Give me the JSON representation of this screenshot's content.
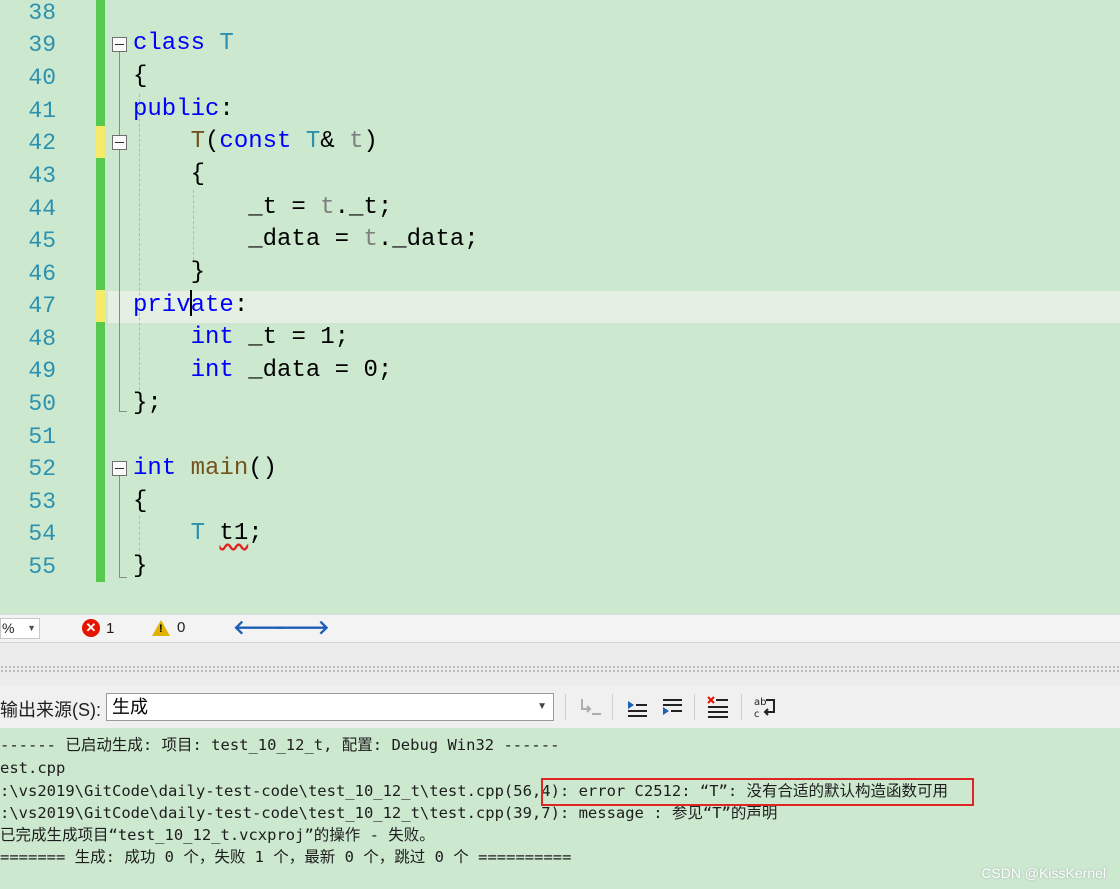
{
  "editor": {
    "line_numbers": [
      "38",
      "39",
      "40",
      "41",
      "42",
      "43",
      "44",
      "45",
      "46",
      "47",
      "48",
      "49",
      "50",
      "51",
      "52",
      "53",
      "54",
      "55"
    ],
    "tokens": {
      "class_kw": "class",
      "class_name": "T",
      "brace_open": "{",
      "brace_close": "}",
      "public_kw": "public",
      "private_kw_a": "priv",
      "private_kw_b": "ate",
      "colon": ":",
      "ctor_name": "T",
      "paren_open": "(",
      "const_kw": "const",
      "param_type": "T",
      "amp": "&",
      "param_name": "t",
      "paren_close": ")",
      "assign_t_left": "_t = ",
      "assign_t_obj": "t",
      "assign_t_right": "._t;",
      "assign_d_left": "_data = ",
      "assign_d_obj": "t",
      "assign_d_right": "._data;",
      "int_kw": "int",
      "member_t": " _t = 1;",
      "member_data": " _data = 0;",
      "class_end": "};",
      "main_name": "main",
      "main_parens": "()",
      "var_type": "T",
      "var_name": "t1",
      "semicolon": ";"
    }
  },
  "statusbar": {
    "zoom": "%",
    "error_count": "1",
    "warning_count": "0"
  },
  "output": {
    "source_label": "输出来源(S):",
    "source_value": "生成",
    "lines": [
      "------ 已启动生成: 项目: test_10_12_t, 配置: Debug Win32 ------",
      "est.cpp",
      ":\\vs2019\\GitCode\\daily-test-code\\test_10_12_t\\test.cpp(56,4): error C2512: “T”: 没有合适的默认构造函数可用",
      ":\\vs2019\\GitCode\\daily-test-code\\test_10_12_t\\test.cpp(39,7): message : 参见“T”的声明",
      "已完成生成项目“test_10_12_t.vcxproj”的操作 - 失败。",
      "======= 生成: 成功 0 个，失败 1 个，最新 0 个，跳过 0 个 =========="
    ]
  },
  "watermark": "CSDN @KissKernel",
  "colors": {
    "background": "#cce8cf",
    "keyword": "#0000ff",
    "type": "#2b91af",
    "function": "#74531f",
    "parameter": "#808080",
    "error_red": "#e02525"
  }
}
